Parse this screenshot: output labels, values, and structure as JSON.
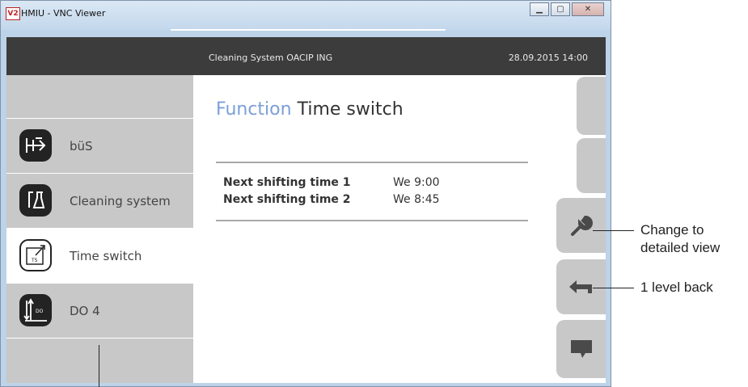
{
  "window": {
    "title": "HMIU - VNC Viewer",
    "icon": "vnc-viewer-icon"
  },
  "header": {
    "system": "Cleaning System  OACIP ING",
    "datetime": "28.09.2015  14:00"
  },
  "sidebar": {
    "items": [
      {
        "label": "büS",
        "icon": "bus-icon"
      },
      {
        "label": "Cleaning system",
        "icon": "cleaning-system-icon"
      },
      {
        "label": "Time switch",
        "icon": "time-switch-icon",
        "active": true
      },
      {
        "label": "DO 4",
        "icon": "digital-output-icon"
      }
    ]
  },
  "main": {
    "title_keyword": "Function",
    "title_name": "Time switch",
    "rows": [
      {
        "label": "Next shifting time 1",
        "value": "We 9:00"
      },
      {
        "label": "Next shifting time 2",
        "value": "We 8:45"
      }
    ]
  },
  "right_buttons": [
    "blank-button",
    "blank-button",
    "wrench-icon",
    "back-arrow-icon",
    "message-icon"
  ],
  "callouts": {
    "detailed_view": [
      "Change to",
      "detailed view"
    ],
    "level_back": "1 level back"
  }
}
